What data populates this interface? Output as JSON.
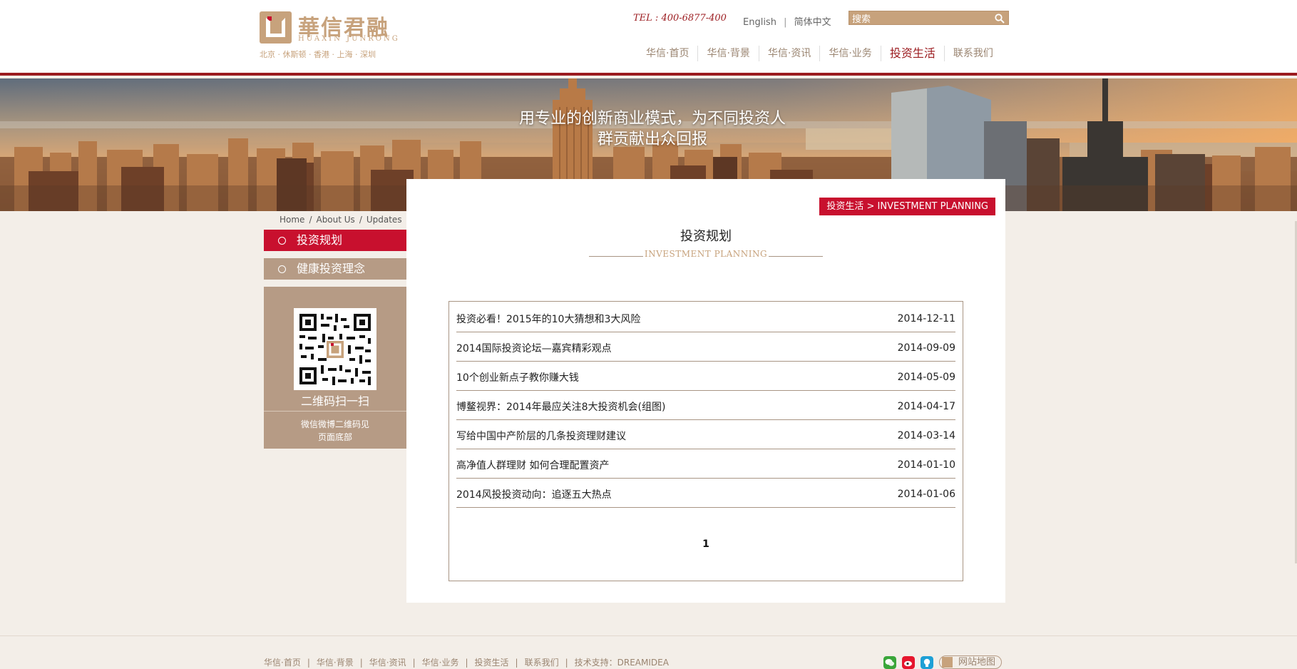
{
  "brand": {
    "name_cn": "華信君融",
    "name_en": "HUAXIN JUNRONG",
    "cities": "北京 · 休斯顿 · 香港 · 上海 · 深圳"
  },
  "header": {
    "tel": "TEL : 400-6877-400",
    "lang_en": "English",
    "lang_sep": "|",
    "lang_cn": "简体中文",
    "search_placeholder": "搜索"
  },
  "nav": [
    {
      "label": "华信·首页"
    },
    {
      "label": "华信·背景"
    },
    {
      "label": "华信·资讯"
    },
    {
      "label": "华信·业务"
    },
    {
      "label": "投资生活"
    },
    {
      "label": "联系我们"
    }
  ],
  "banner": {
    "line1": "用专业的创新商业模式，为不同投资人",
    "line2": "群贡献出众回报"
  },
  "breadcrumb": [
    "Home",
    "About Us",
    "Updates"
  ],
  "breadcrumb_sep": "/",
  "sidebar": {
    "items": [
      {
        "label": "投资规划"
      },
      {
        "label": "健康投资理念"
      }
    ],
    "qr_title": "二维码扫一扫",
    "qr_note_line1": "微信微博二维码见",
    "qr_note_line2": "页面底部"
  },
  "main": {
    "tag": "投资生活 > INVESTMENT PLANNING",
    "title": "投资规划",
    "subtitle": "INVESTMENT PLANNING",
    "articles": [
      {
        "title": "投资必看！2015年的10大猜想和3大风险",
        "date": "2014-12-11"
      },
      {
        "title": "2014国际投资论坛—嘉宾精彩观点",
        "date": "2014-09-09"
      },
      {
        "title": "10个创业新点子教你赚大钱",
        "date": "2014-05-09"
      },
      {
        "title": "博鳌视界：2014年最应关注8大投资机会(组图)",
        "date": "2014-04-17"
      },
      {
        "title": "写给中国中产阶层的几条投资理财建议",
        "date": "2014-03-14"
      },
      {
        "title": "高净值人群理财 如何合理配置资产",
        "date": "2014-01-10"
      },
      {
        "title": "2014风投投资动向：追逐五大热点",
        "date": "2014-01-06"
      }
    ],
    "page": "1"
  },
  "footer": {
    "links": [
      {
        "label": "华信·首页"
      },
      {
        "label": "华信·背景"
      },
      {
        "label": "华信·资讯"
      },
      {
        "label": "华信·业务"
      },
      {
        "label": "投资生活"
      },
      {
        "label": "联系我们"
      },
      {
        "label": "技术支持：DREAMIDEA"
      }
    ],
    "sep": "|",
    "sitemap": "网站地图",
    "icons": [
      "wechat-icon",
      "weibo-icon",
      "qq-icon"
    ]
  },
  "colors": {
    "accent_red": "#c8102e",
    "dark_red": "#9b1b1f",
    "tan": "#b69b85",
    "gold": "#c7a27c",
    "background": "#f3eee8"
  }
}
